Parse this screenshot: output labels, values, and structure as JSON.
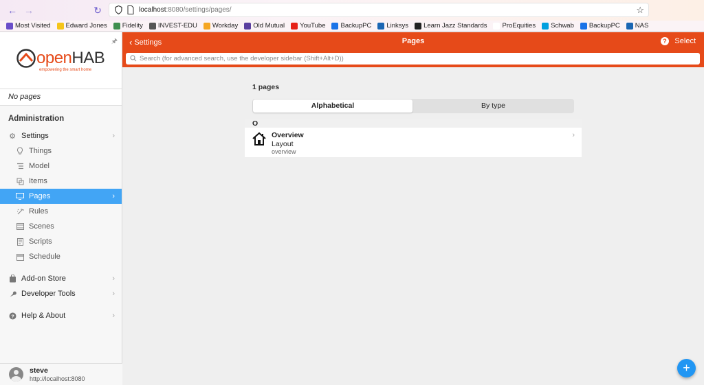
{
  "browser": {
    "url_host": "localhost",
    "url_path": ":8080/settings/pages/",
    "bookmarks": [
      {
        "label": "Most Visited",
        "color": "#6a4fc9",
        "icon": "gear-icon"
      },
      {
        "label": "Edward Jones",
        "color": "#f5c518",
        "icon": "edward-jones-icon"
      },
      {
        "label": "Fidelity",
        "color": "#3f8f4f",
        "icon": "fidelity-icon"
      },
      {
        "label": "INVEST-EDU",
        "color": "#555555",
        "icon": "building-icon"
      },
      {
        "label": "Workday",
        "color": "#f5a623",
        "icon": "workday-icon"
      },
      {
        "label": "Old Mutual",
        "color": "#5b3fa0",
        "icon": "globe-icon"
      },
      {
        "label": "YouTube",
        "color": "#e62117",
        "icon": "youtube-icon"
      },
      {
        "label": "BackupPC",
        "color": "#1a73e8",
        "icon": "file-icon"
      },
      {
        "label": "Linksys",
        "color": "#1a66b3",
        "icon": "linksys-icon"
      },
      {
        "label": "Learn Jazz Standards",
        "color": "#222222",
        "icon": "jazz-icon"
      },
      {
        "label": "ProEquities",
        "color": "#ffffff",
        "icon": "proequities-icon"
      },
      {
        "label": "Schwab",
        "color": "#00a0df",
        "icon": "schwab-icon"
      },
      {
        "label": "BackupPC",
        "color": "#1a73e8",
        "icon": "file-icon"
      },
      {
        "label": "NAS",
        "color": "#1a66b3",
        "icon": "nas-icon"
      }
    ]
  },
  "sidebar": {
    "logo": {
      "brand_open": "open",
      "brand_hab": "HAB",
      "tagline": "empowering the smart home"
    },
    "no_pages": "No pages",
    "admin_title": "Administration",
    "settings": "Settings",
    "sub_items": [
      {
        "label": "Things",
        "icon": "bulb-icon"
      },
      {
        "label": "Model",
        "icon": "model-icon"
      },
      {
        "label": "Items",
        "icon": "items-icon"
      },
      {
        "label": "Pages",
        "icon": "monitor-icon"
      },
      {
        "label": "Rules",
        "icon": "wand-icon"
      },
      {
        "label": "Scenes",
        "icon": "film-icon"
      },
      {
        "label": "Scripts",
        "icon": "script-icon"
      },
      {
        "label": "Schedule",
        "icon": "calendar-icon"
      }
    ],
    "addon_store": "Add-on Store",
    "developer_tools": "Developer Tools",
    "help_about": "Help & About",
    "user": {
      "name": "steve",
      "url": "http://localhost:8080"
    }
  },
  "header": {
    "back_label": "Settings",
    "title": "Pages",
    "select_label": "Select",
    "search_placeholder": "Search (for advanced search, use the developer sidebar (Shift+Alt+D))"
  },
  "main": {
    "count": "1 pages",
    "tabs": [
      {
        "label": "Alphabetical",
        "active": true
      },
      {
        "label": "By type",
        "active": false
      }
    ],
    "group_letter": "O",
    "items": [
      {
        "title": "Overview",
        "type": "Layout",
        "uid": "overview"
      }
    ]
  },
  "colors": {
    "brand": "#e64a19",
    "active": "#42a5f5",
    "fab": "#2196f3"
  }
}
